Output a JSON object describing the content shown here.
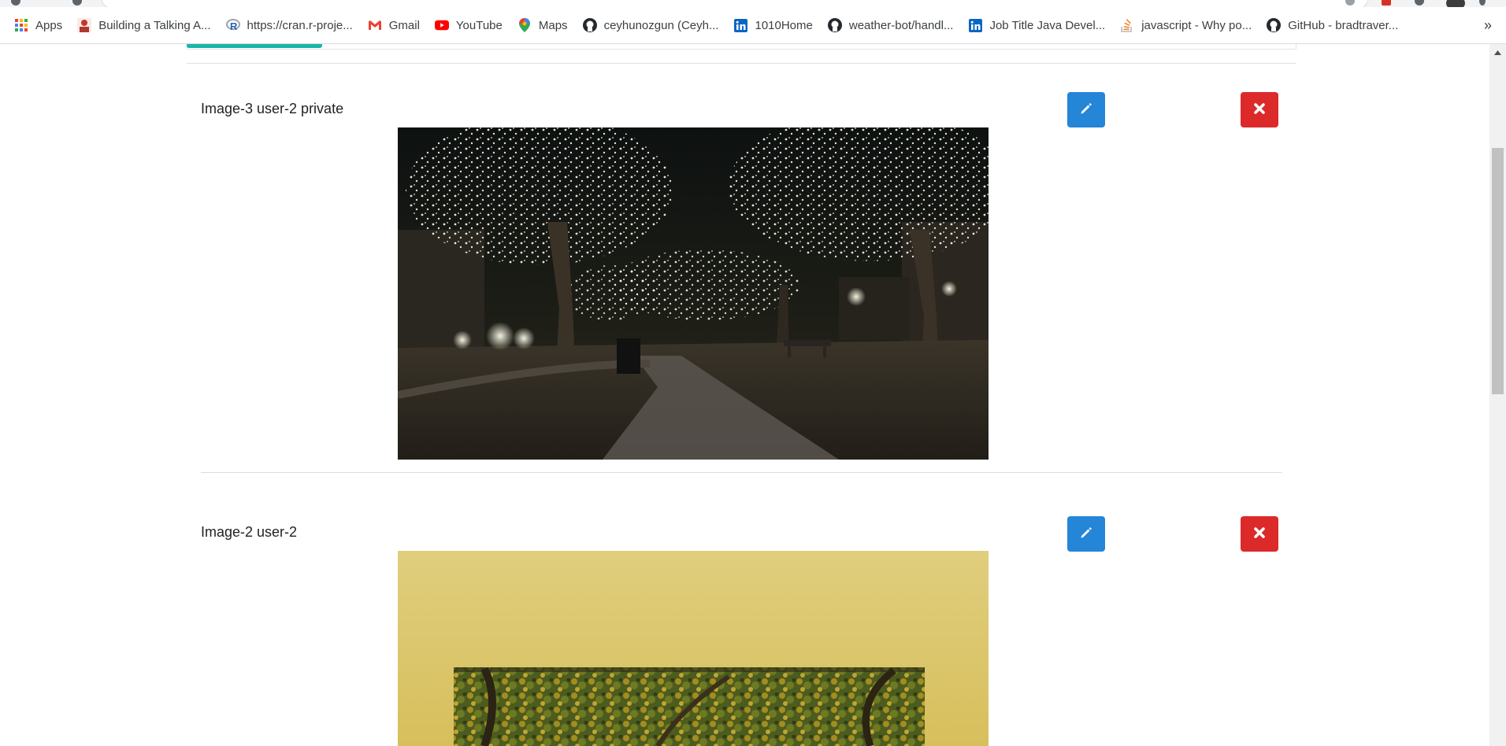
{
  "bookmarks": [
    {
      "label": "Apps",
      "icon": "apps-grid-icon"
    },
    {
      "label": "Building a Talking A...",
      "icon": "person-thumbnail-icon"
    },
    {
      "label": "https://cran.r-proje...",
      "icon": "r-logo-icon"
    },
    {
      "label": "Gmail",
      "icon": "gmail-icon"
    },
    {
      "label": "YouTube",
      "icon": "youtube-icon"
    },
    {
      "label": "Maps",
      "icon": "maps-pin-icon"
    },
    {
      "label": "ceyhunozgun (Ceyh...",
      "icon": "github-icon"
    },
    {
      "label": "1010Home",
      "icon": "linkedin-icon"
    },
    {
      "label": "weather-bot/handl...",
      "icon": "github-icon"
    },
    {
      "label": "Job Title Java Devel...",
      "icon": "linkedin-icon"
    },
    {
      "label": "javascript - Why po...",
      "icon": "stackoverflow-icon"
    },
    {
      "label": "GitHub - bradtraver...",
      "icon": "github-icon"
    }
  ],
  "bookmarks_overflow": "»",
  "posts": [
    {
      "title": "Image-3 user-2 private",
      "edit_icon": "pencil-icon",
      "delete_icon": "close-x-icon",
      "image": "night-park-lights-photo"
    },
    {
      "title": "Image-2 user-2",
      "edit_icon": "pencil-icon",
      "delete_icon": "close-x-icon",
      "image": "autumn-trees-poster-photo"
    }
  ],
  "colors": {
    "tab_accent": "#1ab6a8",
    "edit_button": "#2585d6",
    "delete_button": "#dc2a2a"
  }
}
